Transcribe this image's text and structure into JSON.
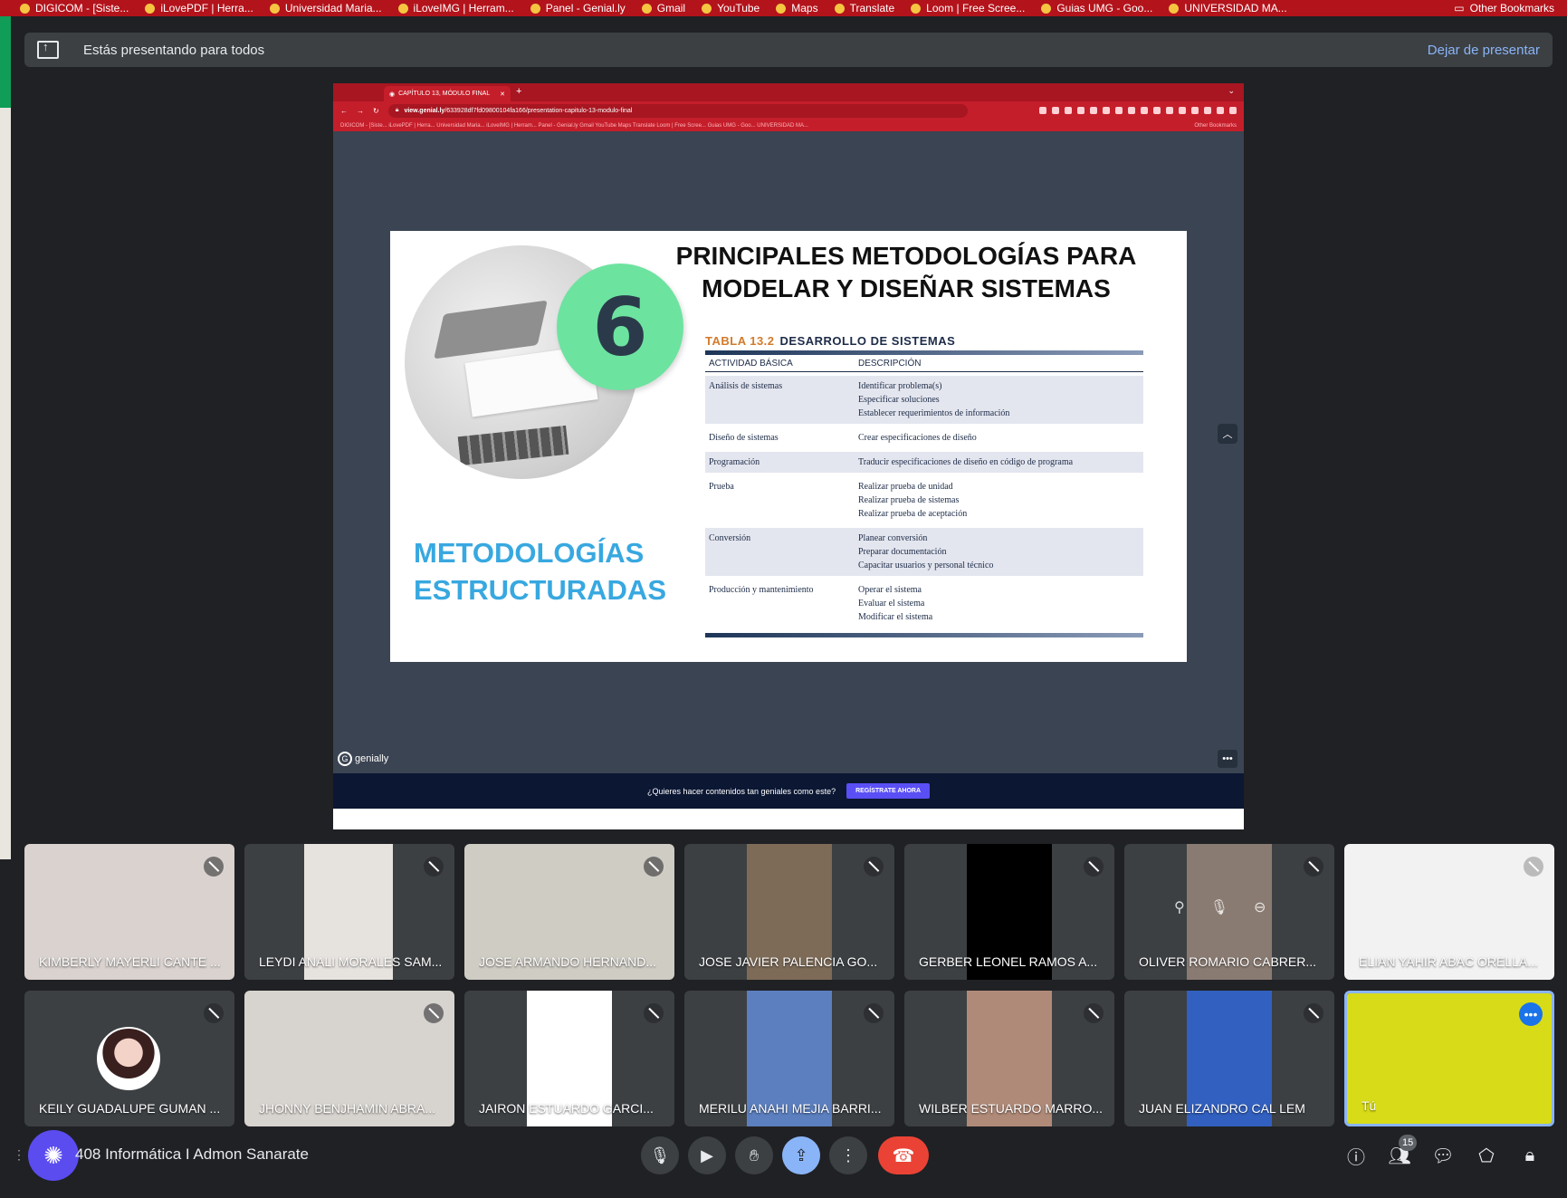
{
  "outer_bookmarks": [
    "DIGICOM - [Siste...",
    "iLovePDF | Herra...",
    "Universidad Maria...",
    "iLoveIMG | Herram...",
    "Panel - Genial.ly",
    "Gmail",
    "YouTube",
    "Maps",
    "Translate",
    "Loom | Free Scree...",
    "Guias UMG - Goo...",
    "UNIVERSIDAD MA...",
    "Other Bookmarks"
  ],
  "banner": {
    "text": "Estás presentando para todos",
    "stop_label": "Dejar de presentar"
  },
  "shared_screen": {
    "tab_title": "CAPÍTULO 13, MÓDULO FINAL",
    "url_domain": "view.genial.ly",
    "url_path": "/633928df7fd09800104fa166/presentation-capitulo-13-modulo-final",
    "inner_bookmarks": "DIGICOM - [Siste...   iLovePDF | Herra...   Universidad Maria...   iLoveIMG | Herram...   Panel - Genial.ly   Gmail   YouTube   Maps   Translate   Loom | Free Scree...   Guias UMG - Goo...   UNIVERSIDAD MA...",
    "inner_other_bookmarks": "Other Bookmarks",
    "slide": {
      "number": "6",
      "title_line1": "PRINCIPALES METODOLOGÍAS PARA",
      "title_line2": "MODELAR Y DISEÑAR SISTEMAS",
      "subtitle_line1": "METODOLOGÍAS",
      "subtitle_line2": "ESTRUCTURADAS",
      "table": {
        "label": "TABLA 13.2",
        "caption": "DESARROLLO DE SISTEMAS",
        "headers": [
          "ACTIVIDAD BÁSICA",
          "DESCRIPCIÓN"
        ],
        "rows": [
          {
            "activity": "Análisis de sistemas",
            "desc": [
              "Identificar problema(s)",
              "Especificar soluciones",
              "Establecer requerimientos de información"
            ]
          },
          {
            "activity": "Diseño de sistemas",
            "desc": [
              "Crear especificaciones de diseño"
            ]
          },
          {
            "activity": "Programación",
            "desc": [
              "Traducir especificaciones de diseño en código de programa"
            ]
          },
          {
            "activity": "Prueba",
            "desc": [
              "Realizar prueba de unidad",
              "Realizar prueba de sistemas",
              "Realizar prueba de aceptación"
            ]
          },
          {
            "activity": "Conversión",
            "desc": [
              "Planear conversión",
              "Preparar documentación",
              "Capacitar usuarios y personal técnico"
            ]
          },
          {
            "activity": "Producción y mantenimiento",
            "desc": [
              "Operar el sistema",
              "Evaluar el sistema",
              "Modificar el sistema"
            ]
          }
        ]
      }
    },
    "genially_label": "genially",
    "promo_text": "¿Quieres hacer contenidos tan geniales como este?",
    "promo_cta": "REGÍSTRATE AHORA"
  },
  "participants": [
    {
      "name": "KIMBERLY MAYERLI CANTE ...",
      "bg": "#d9d2cf"
    },
    {
      "name": "LEYDI ANALI MORALES SAM...",
      "bg": "#e6e2de"
    },
    {
      "name": "JOSE ARMANDO HERNAND...",
      "bg": "#cfccc4"
    },
    {
      "name": "JOSE JAVIER PALENCIA GO...",
      "bg": "#7d6b58"
    },
    {
      "name": "GERBER LEONEL RAMOS A...",
      "bg": "#000000"
    },
    {
      "name": "OLIVER ROMARIO CABRER...",
      "bg": "#8a7b72"
    },
    {
      "name": "ELIAN YAHIR ABAC ORELLA...",
      "bg": "#f2f2f2"
    },
    {
      "name": "KEILY GUADALUPE GUMAN ...",
      "bg": ""
    },
    {
      "name": "JHONNY BENJHAMIN ABRA...",
      "bg": "#d7d3ce"
    },
    {
      "name": "JAIRON ESTUARDO GARCI...",
      "bg": "#ffffff"
    },
    {
      "name": "MERILU ANAHI MEJIA BARRI...",
      "bg": "#5c7fc0"
    },
    {
      "name": "WILBER ESTUARDO MARRO...",
      "bg": "#b08a78"
    },
    {
      "name": "JUAN ELIZANDRO CAL LEM",
      "bg": "#3260c0"
    },
    {
      "name": "Tú",
      "bg": "#d8dc18"
    }
  ],
  "bottom": {
    "meeting_name": "408 Informática I Admon Sanarate",
    "participant_count": "15"
  },
  "colors": {
    "accent": "#8ab4f8",
    "leave": "#ea4335",
    "slide_badge": "#6de3a0",
    "slide_subtitle": "#38a8e0"
  },
  "icons": [
    "present-screen-icon",
    "mic-icon",
    "camera-icon",
    "raise-hand-icon",
    "present-now-icon",
    "more-options-icon",
    "leave-call-icon",
    "info-icon",
    "people-icon",
    "chat-icon",
    "activities-icon",
    "host-controls-icon"
  ]
}
